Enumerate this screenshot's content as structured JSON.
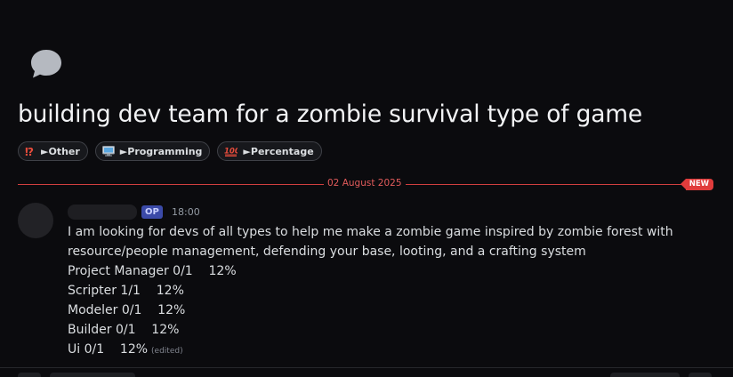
{
  "thread": {
    "title": "building dev team for a zombie survival type of game",
    "tags": [
      {
        "emoji": "interrobang",
        "label": "►Other",
        "color": "#e74c3c"
      },
      {
        "emoji": "computer-monitor",
        "label": "►Programming",
        "color": "#5aa7e0"
      },
      {
        "emoji": "hundred-points",
        "label": "►Percentage",
        "color": "#e74c3c"
      }
    ]
  },
  "divider": {
    "date": "02 August 2025",
    "new_label": "NEW"
  },
  "post": {
    "op_badge": "OP",
    "time": "18:00",
    "intro": "I am looking for devs of all types to help me make a zombie game inspired by zombie forest with resource/people management, defending your base, looting, and a crafting system",
    "roles": [
      "Project Manager 0/1    12%",
      "Scripter 1/1    12%",
      "Modeler 0/1    12%",
      "Builder 0/1    12%",
      "Ui 0/1    12%"
    ],
    "edited_label": "(edited)"
  },
  "colors": {
    "background": "#0b0b0e",
    "accent_red": "#e03c3c",
    "op_badge": "#3b4aa8"
  }
}
